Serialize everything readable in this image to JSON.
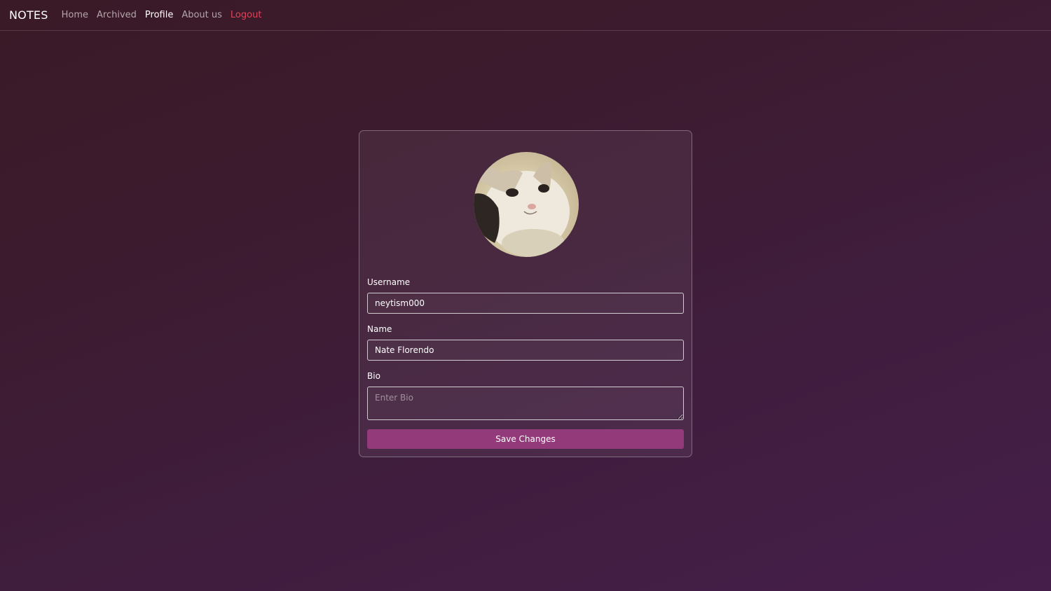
{
  "nav": {
    "brand": "NOTES",
    "links": [
      {
        "label": "Home"
      },
      {
        "label": "Archived"
      },
      {
        "label": "Profile",
        "active": true
      },
      {
        "label": "About us"
      },
      {
        "label": "Logout"
      }
    ]
  },
  "profile": {
    "avatar_icon": "cat-avatar",
    "username_label": "Username",
    "username_value": "neytism000",
    "name_label": "Name",
    "name_value": "Nate Florendo",
    "bio_label": "Bio",
    "bio_placeholder": "Enter Bio",
    "bio_value": "",
    "save_label": "Save Changes"
  },
  "colors": {
    "logout": "#e0435a",
    "button": "#933a7a"
  }
}
